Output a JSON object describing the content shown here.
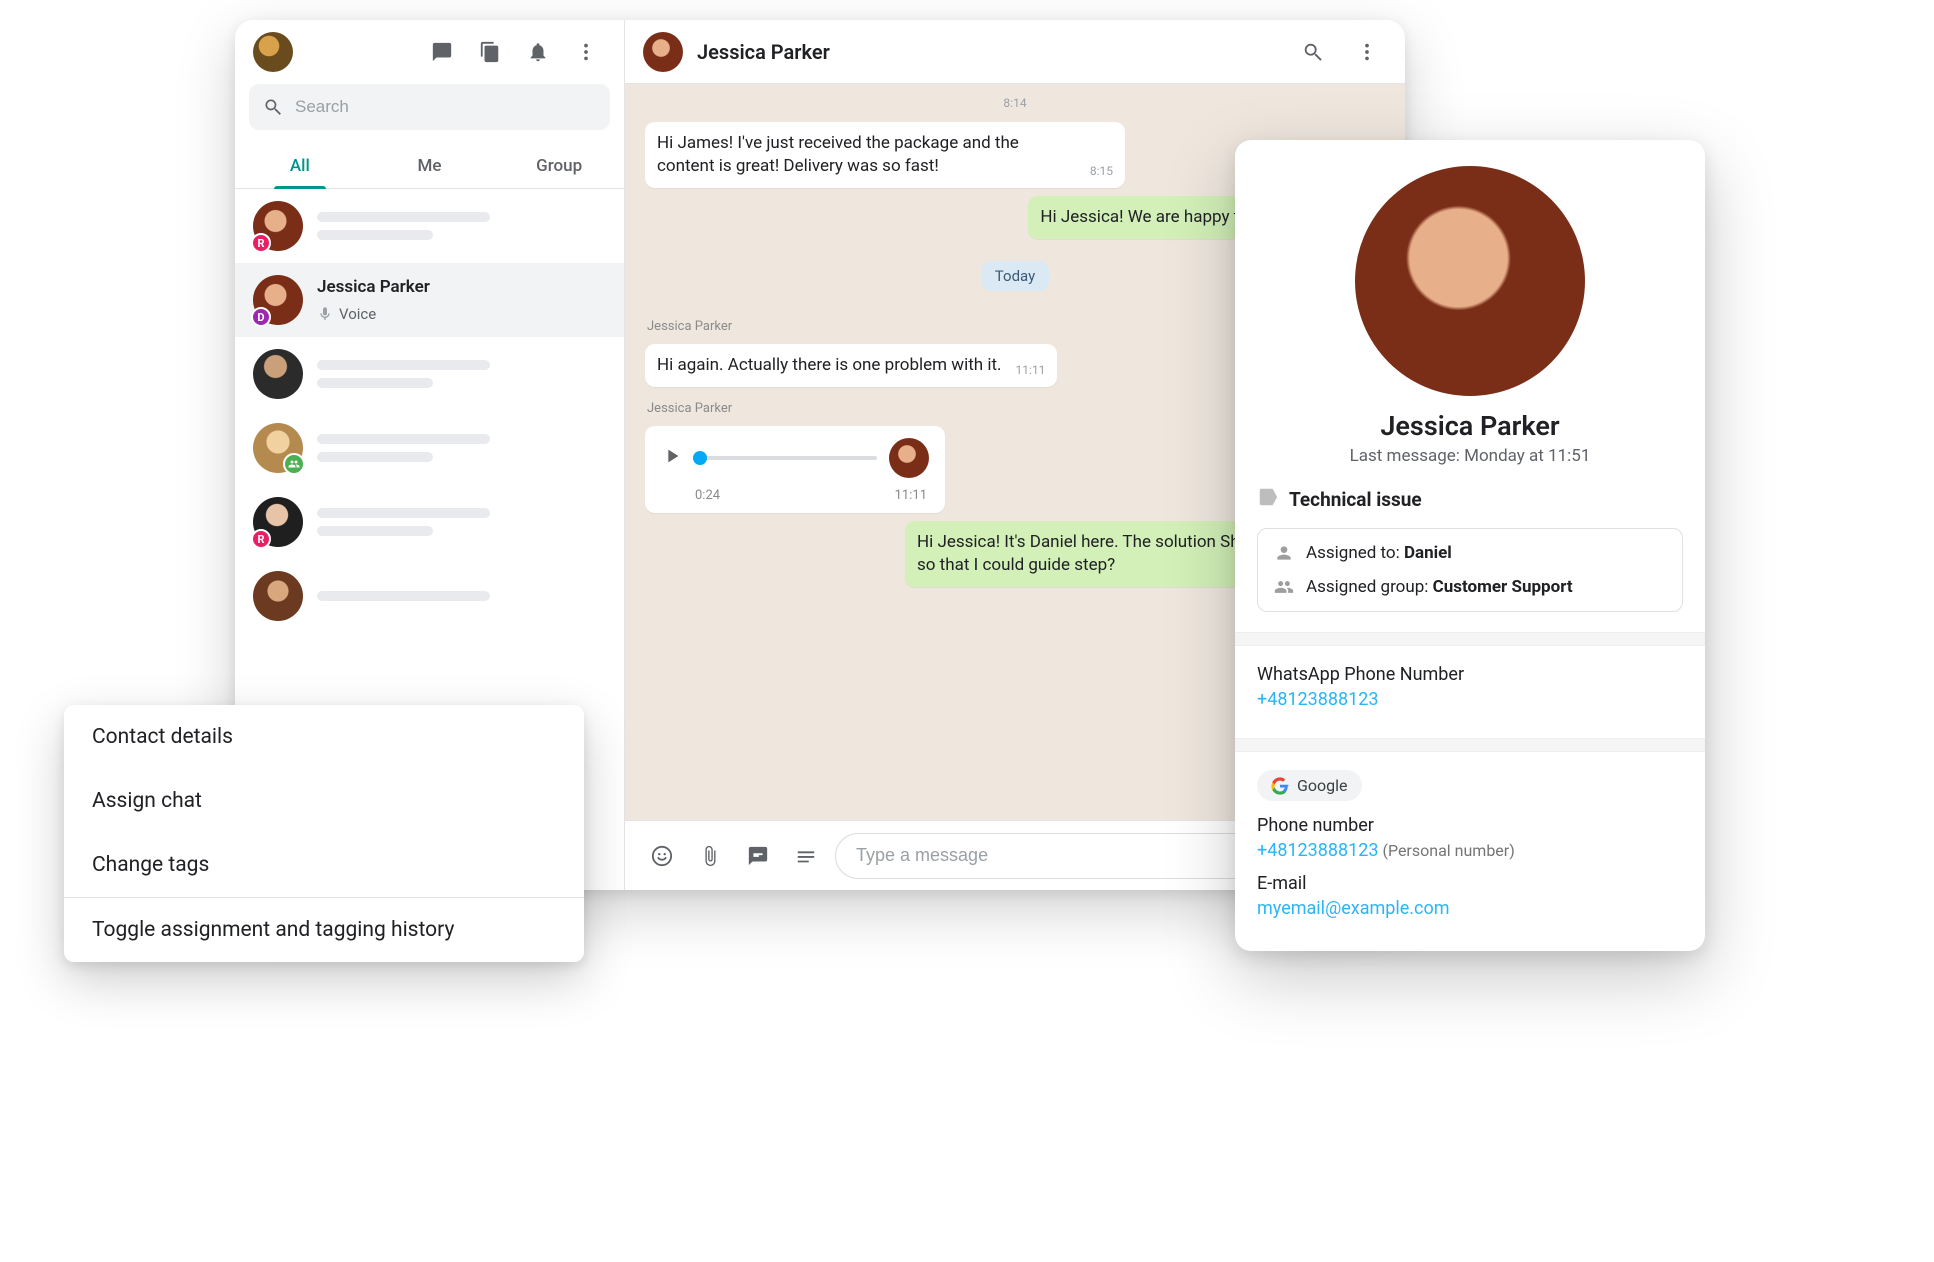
{
  "sidebar": {
    "search_placeholder": "Search",
    "tabs": {
      "all": "All",
      "me": "Me",
      "group": "Group"
    },
    "chats": {
      "item0_badge": "R",
      "item3_badge": "R",
      "selected": {
        "name": "Jessica Parker",
        "sub": "Voice",
        "badge": "D"
      }
    }
  },
  "chat": {
    "header_name": "Jessica Parker",
    "loose_ts_top": "8:14",
    "msg_in_1": {
      "text": "Hi James! I've just received the package and the content is great! Delivery was so fast!",
      "time": "8:15"
    },
    "msg_out_1": {
      "text": "Hi Jessica! We are happy to hear that! order!"
    },
    "day_chip": "Today",
    "sender_1": "Jessica Parker",
    "msg_in_2": {
      "text": "Hi again. Actually there is one problem with it.",
      "time": "11:11"
    },
    "sender_2": "Jessica Parker",
    "voice": {
      "elapsed": "0:24",
      "time": "11:11"
    },
    "msg_out_2": {
      "text": "Hi Jessica! It's Daniel here. The solution Shall we have a call so that I could guide step?"
    },
    "composer_placeholder": "Type a message"
  },
  "context_menu": {
    "item0": "Contact details",
    "item1": "Assign chat",
    "item2": "Change tags",
    "item3": "Toggle assignment and tagging history"
  },
  "details": {
    "name": "Jessica Parker",
    "last_msg": "Last message: Monday at 11:51",
    "tag": "Technical issue",
    "assigned_label": "Assigned to: ",
    "assigned_value": "Daniel",
    "group_label": "Assigned group: ",
    "group_value": "Customer Support",
    "wa_label": "WhatsApp Phone Number",
    "wa_value": "+48123888123",
    "google_chip": "Google",
    "phone_label": "Phone number",
    "phone_value": "+48123888123",
    "phone_note": "(Personal number)",
    "email_label": "E-mail",
    "email_value": "myemail@example.com"
  }
}
